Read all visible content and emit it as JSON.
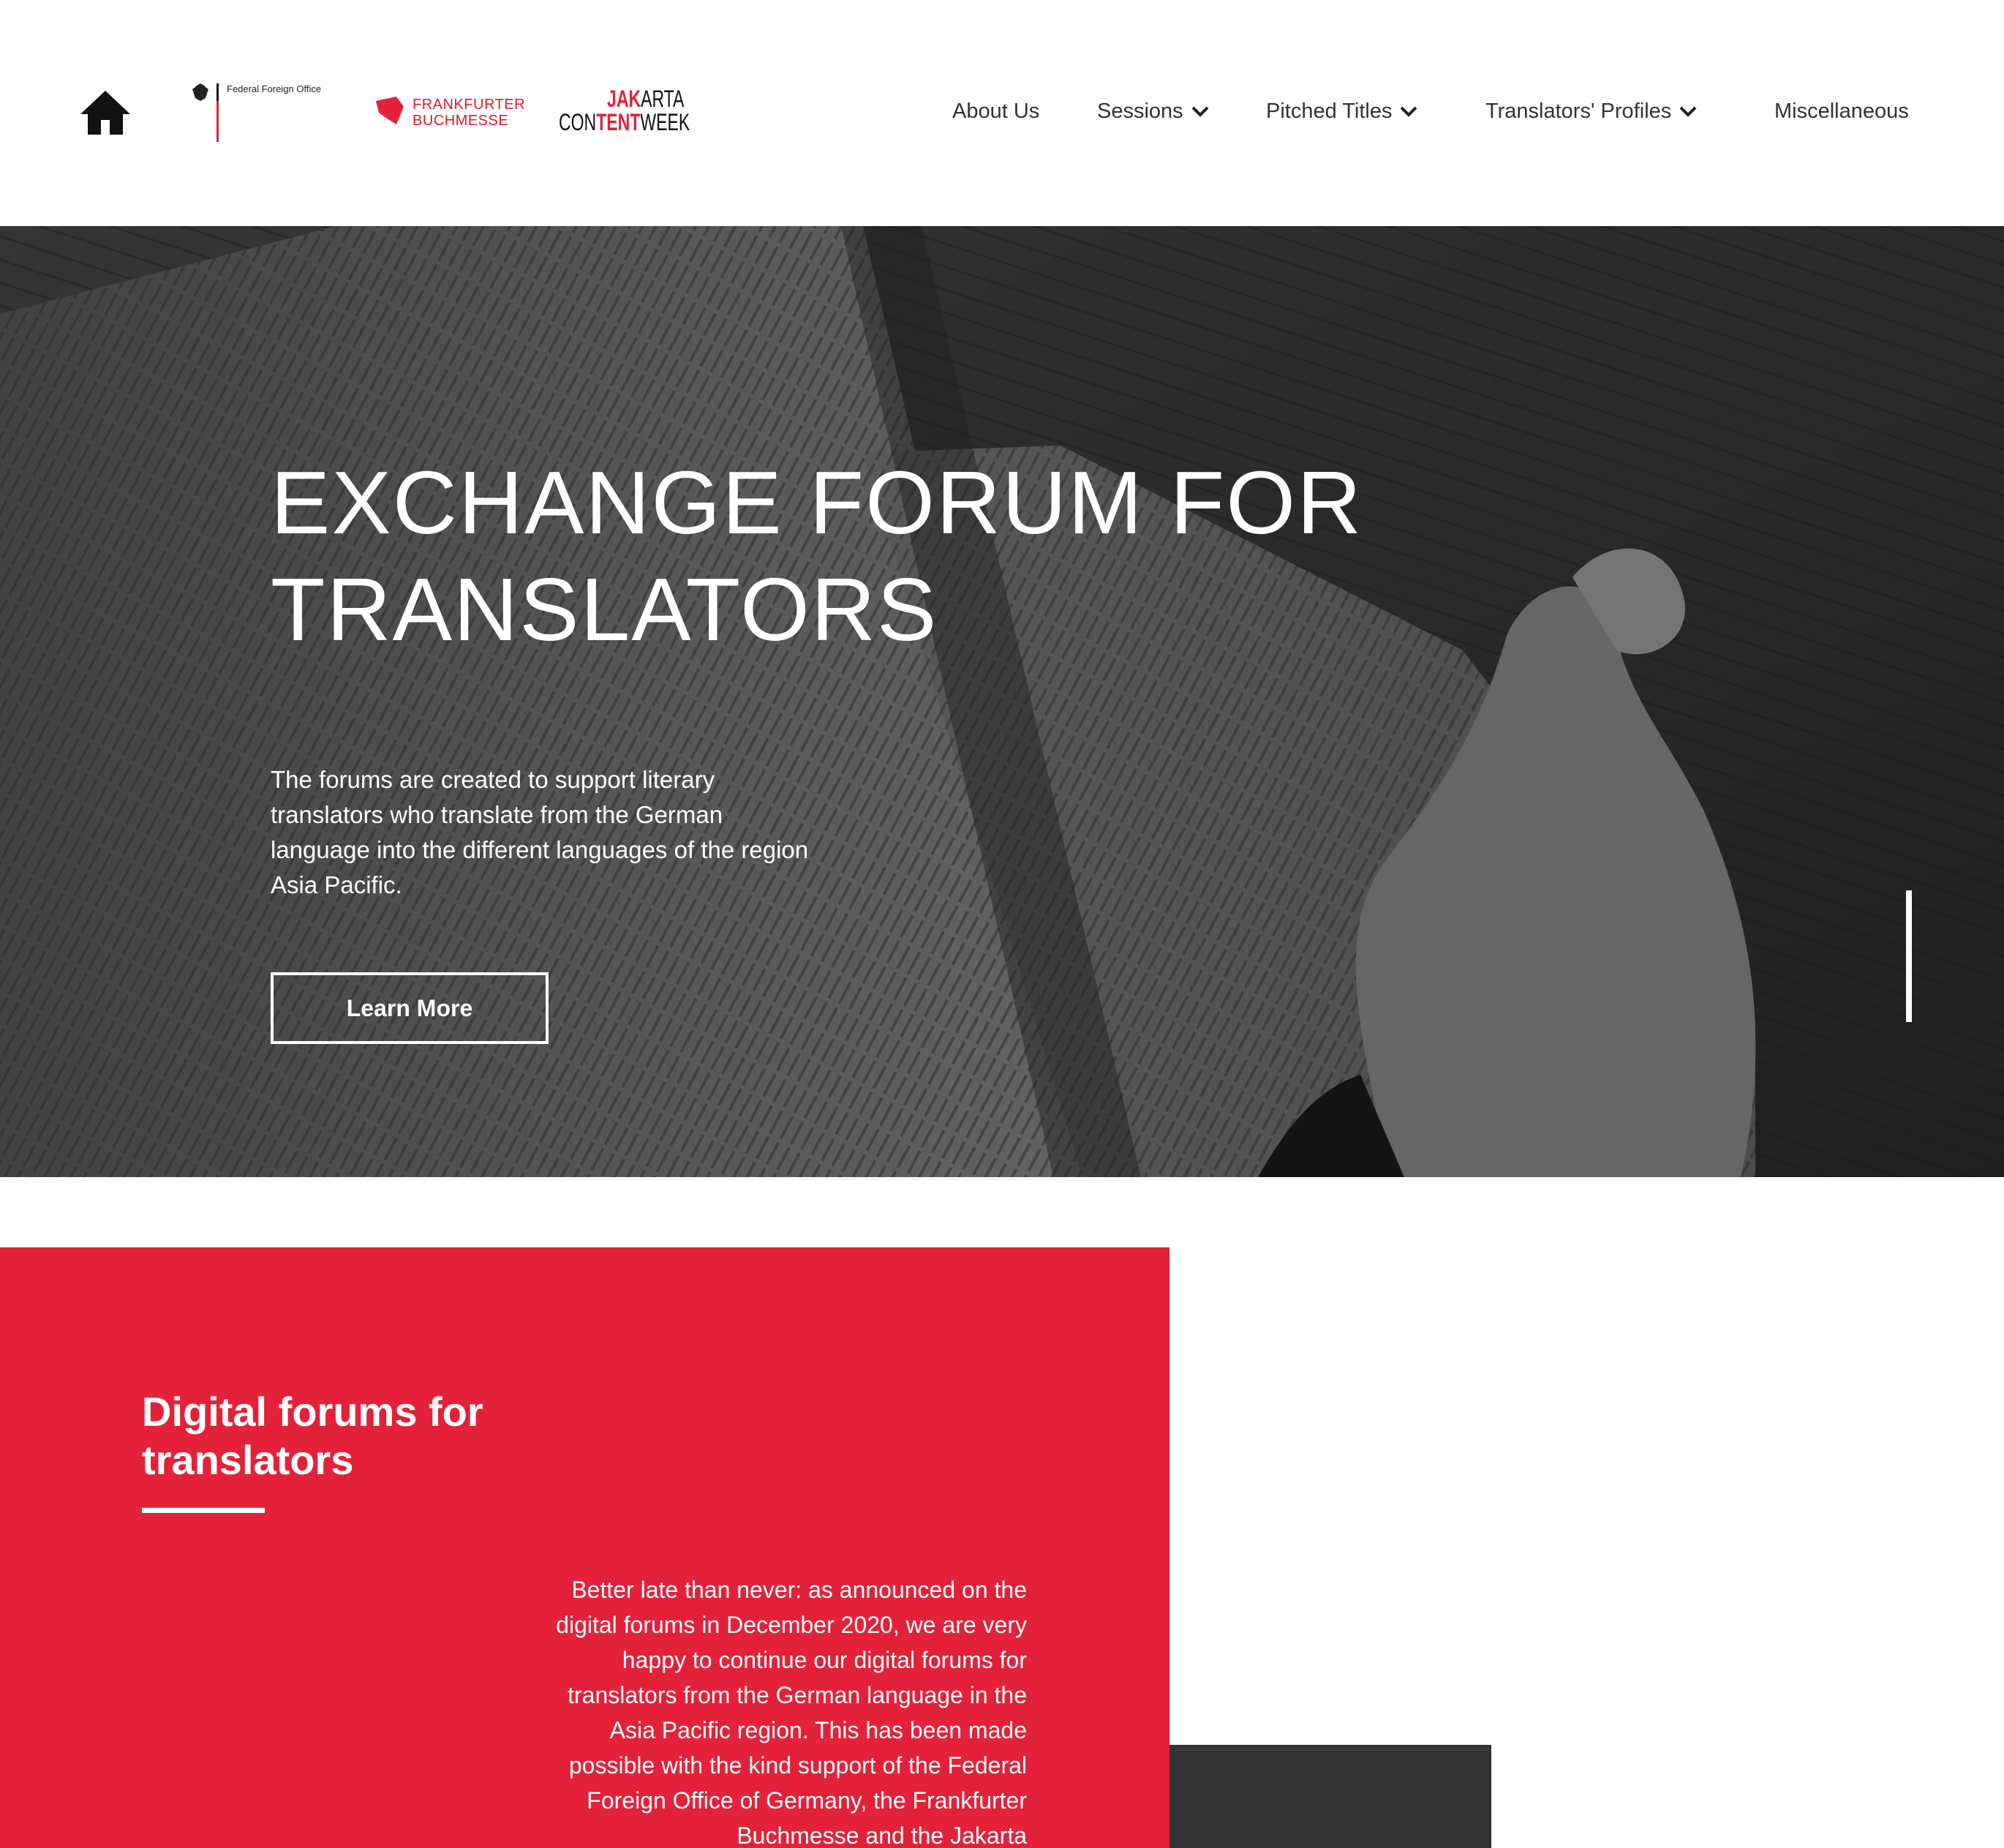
{
  "header": {
    "logos": {
      "federal_foreign_office": "Federal Foreign Office",
      "frankfurter_buchmesse_line1": "FRANKFURTER",
      "frankfurter_buchmesse_line2": "BUCHMESSE",
      "jakarta_content_week_1a": "JAK",
      "jakarta_content_week_1b": "ARTA",
      "jakarta_content_week_2a": "CON",
      "jakarta_content_week_2b": "TENT",
      "jakarta_content_week_2c": "WEEK"
    },
    "nav": {
      "about": "About Us",
      "sessions": "Sessions",
      "pitched_titles": "Pitched Titles",
      "translators_profiles": "Translators' Profiles",
      "miscellaneous": "Miscellaneous"
    },
    "icons": [
      "home-icon",
      "chevron-down-icon"
    ]
  },
  "hero": {
    "title": "EXCHANGE FORUM FOR TRANSLATORS",
    "description": "The forums are created to support literary translators who translate from the German language into the different languages of the region Asia Pacific.",
    "button_label": "Learn More"
  },
  "section": {
    "title": "Digital forums for translators",
    "body": "Better late than never: as announced on the digital forums in December 2020, we are very happy to continue our digital forums for translators from the German language in the Asia Pacific region. This has been made possible with the kind support of the Federal Foreign Office of Germany, the Frankfurter Buchmesse and the Jakarta"
  },
  "colors": {
    "accent_red": "#e3223a",
    "dark_block": "#333333",
    "header_bg": "#ffffff"
  }
}
